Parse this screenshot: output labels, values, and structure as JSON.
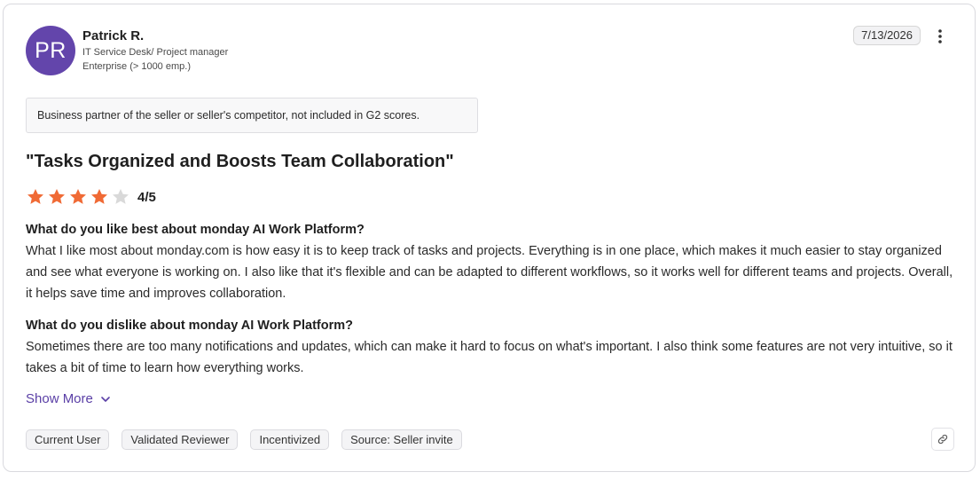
{
  "reviewer": {
    "initials": "PR",
    "name": "Patrick R.",
    "role": "IT Service Desk/ Project manager",
    "company_size": "Enterprise (> 1000 emp.)",
    "avatar_color": "#6345ab"
  },
  "date": "7/13/2026",
  "disclaimer": "Business partner of the seller or seller's competitor, not included in G2 scores.",
  "title": "\"Tasks Organized and Boosts Team Collaboration\"",
  "rating": {
    "value": 4,
    "max": 5,
    "label": "4/5",
    "star_color": "#f06a35",
    "empty_star_color": "#d9d9d9"
  },
  "qa": [
    {
      "question": "What do you like best about monday AI Work Platform?",
      "answer": "What I like most about monday.com is how easy it is to keep track of tasks and projects. Everything is in one place, which makes it much easier to stay organized and see what everyone is working on. I also like that it's flexible and can be adapted to different workflows, so it works well for different teams and projects. Overall, it helps save time and improves collaboration."
    },
    {
      "question": "What do you dislike about monday AI Work Platform?",
      "answer": "Sometimes there are too many notifications and updates, which can make it hard to focus on what's important. I also think some features are not very intuitive, so it takes a bit of time to learn how everything works."
    }
  ],
  "show_more_label": "Show More",
  "tags": [
    "Current User",
    "Validated Reviewer",
    "Incentivized",
    "Source: Seller invite"
  ],
  "icons": {
    "menu": "more-vertical-icon",
    "chevron": "chevron-down-icon",
    "link": "link-icon"
  }
}
